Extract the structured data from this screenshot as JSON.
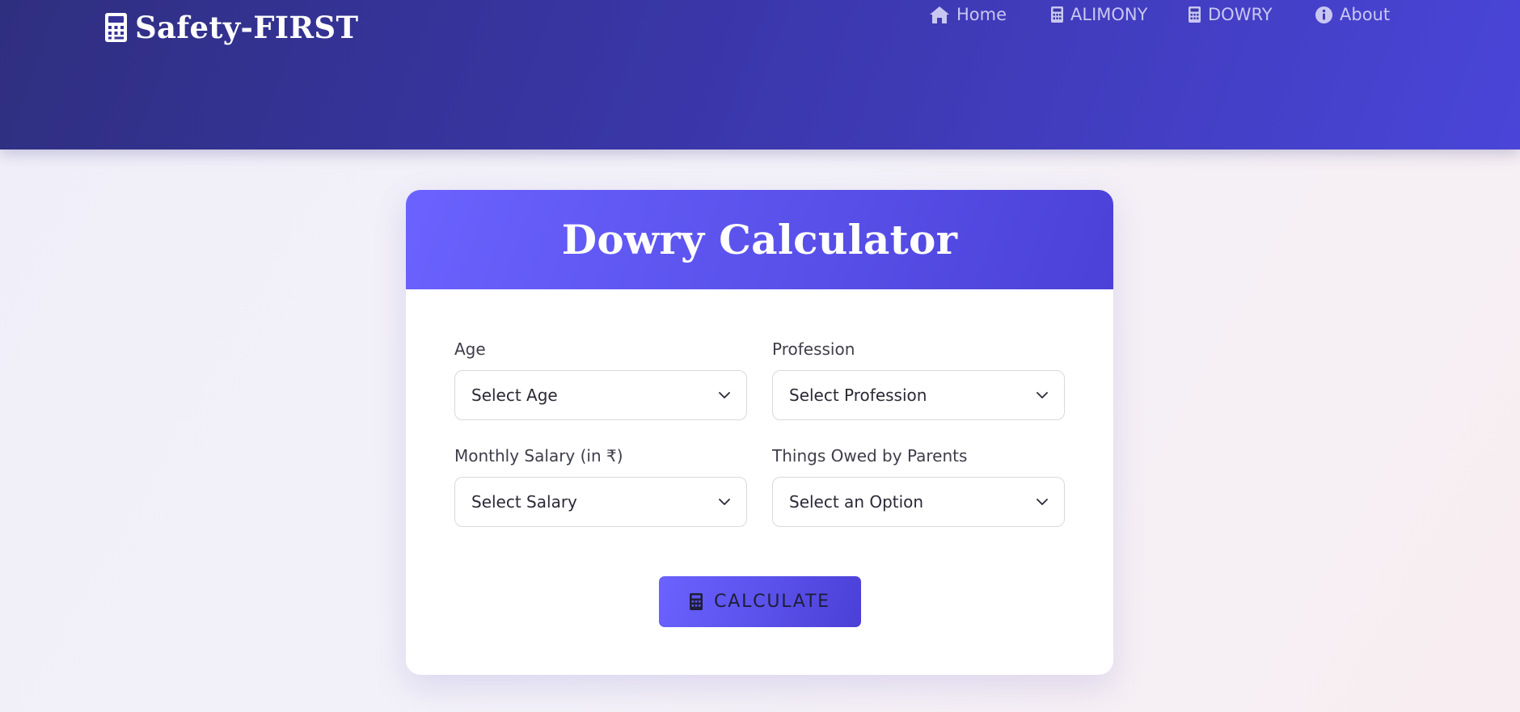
{
  "header": {
    "brand_title": "Safety-FIRST",
    "brand_icon": "calculator-icon",
    "nav": [
      {
        "label": "Home",
        "icon": "home-icon"
      },
      {
        "label": "ALIMONY",
        "icon": "calculator-icon"
      },
      {
        "label": "DOWRY",
        "icon": "calculator-icon"
      },
      {
        "label": "About",
        "icon": "info-icon"
      }
    ]
  },
  "card": {
    "title": "Dowry Calculator",
    "fields": {
      "age": {
        "label": "Age",
        "value": "Select Age"
      },
      "profession": {
        "label": "Profession",
        "value": "Select Profession"
      },
      "salary": {
        "label": "Monthly Salary (in ₹)",
        "value": "Select Salary"
      },
      "owed": {
        "label": "Things Owed by Parents",
        "value": "Select an Option"
      }
    },
    "button": {
      "label": "CALCULATE",
      "icon": "calculator-icon"
    }
  },
  "colors": {
    "header_start": "#2f2f80",
    "header_end": "#4a45d8",
    "accent": "#5b52ec",
    "nav_text": "#c9c7f2"
  }
}
